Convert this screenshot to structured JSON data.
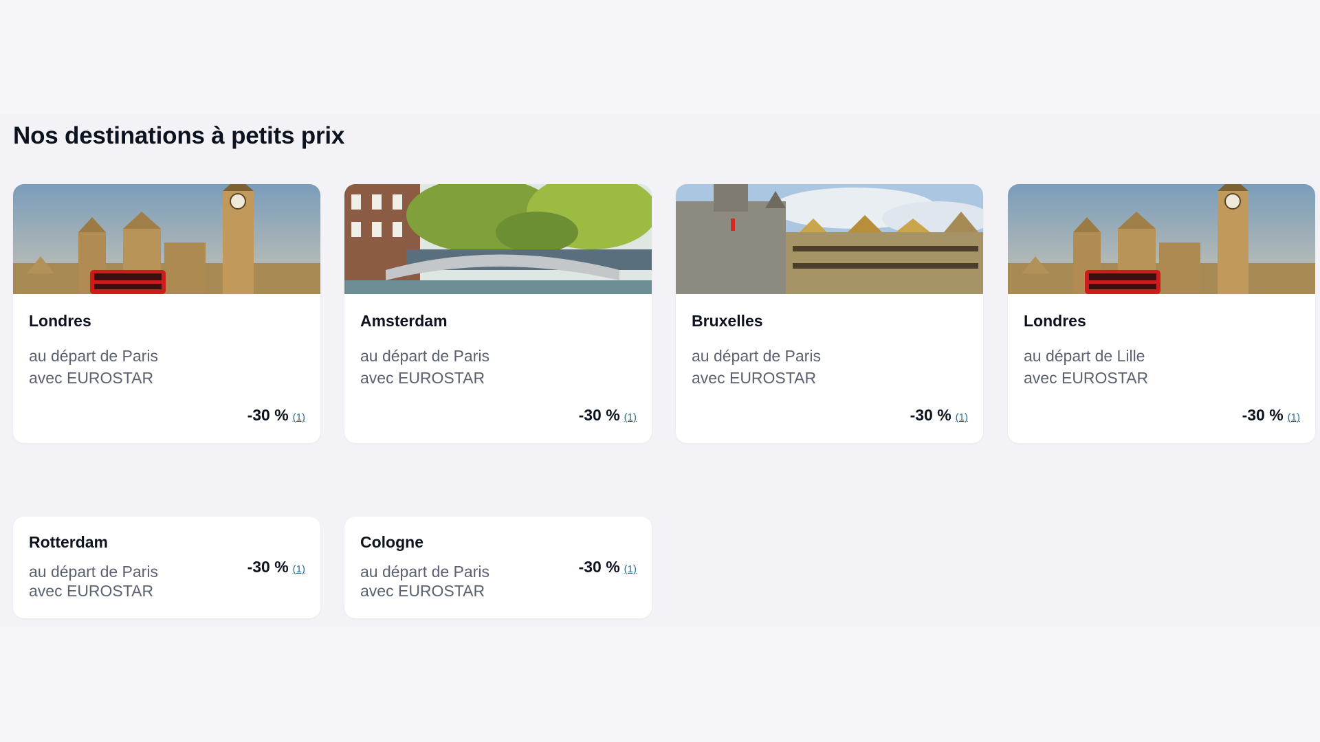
{
  "section": {
    "title": "Nos destinations à petits prix"
  },
  "cards": [
    {
      "city": "Londres",
      "line1": "au départ de Paris",
      "line2": "avec EUROSTAR",
      "price": "-30 %",
      "note": "(1)",
      "image": "london-big-ben-photo"
    },
    {
      "city": "Amsterdam",
      "line1": "au départ de Paris",
      "line2": "avec EUROSTAR",
      "price": "-30 %",
      "note": "(1)",
      "image": "amsterdam-canal-bridge-photo"
    },
    {
      "city": "Bruxelles",
      "line1": "au départ de Paris",
      "line2": "avec EUROSTAR",
      "price": "-30 %",
      "note": "(1)",
      "image": "brussels-grand-place-photo"
    },
    {
      "city": "Londres",
      "line1": "au départ de Lille",
      "line2": "avec EUROSTAR",
      "price": "-30 %",
      "note": "(1)",
      "image": "london-big-ben-photo"
    },
    {
      "city": "Rotterdam",
      "line1": "au départ de Paris",
      "line2": "avec EUROSTAR",
      "price": "-30 %",
      "note": "(1)"
    },
    {
      "city": "Cologne",
      "line1": "au départ de Paris",
      "line2": "avec EUROSTAR",
      "price": "-30 %",
      "note": "(1)"
    }
  ],
  "colors": {
    "page_background": "#f3f3f7",
    "card_background": "#ffffff",
    "title_text": "#0c131f",
    "secondary_text": "#5b6170",
    "footnote_link": "#2a6f91"
  }
}
